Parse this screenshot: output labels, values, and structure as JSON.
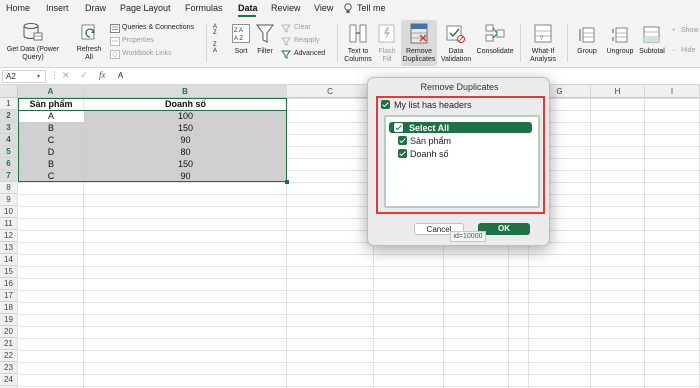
{
  "menu": {
    "tabs": [
      "Home",
      "Insert",
      "Draw",
      "Page Layout",
      "Formulas",
      "Data",
      "Review",
      "View"
    ],
    "active_tab": "Data",
    "tell_me": "Tell me"
  },
  "ribbon": {
    "get_data": [
      "Get Data (Power",
      "Query)"
    ],
    "refresh_all": [
      "Refresh",
      "All"
    ],
    "queries_connections": "Queries & Connections",
    "properties": "Properties",
    "workbook_links": "Workbook Links",
    "sort": "Sort",
    "filter": "Filter",
    "clear": "Clear",
    "reapply": "Reapply",
    "advanced": "Advanced",
    "text_to_columns": [
      "Text to",
      "Columns"
    ],
    "flash_fill": [
      "Flash",
      "Fill"
    ],
    "remove_duplicates": [
      "Remove",
      "Duplicates"
    ],
    "data_validation": [
      "Data",
      "Validation"
    ],
    "consolidate": "Consolidate",
    "what_if": [
      "What-If",
      "Analysis"
    ],
    "group": "Group",
    "ungroup": "Ungroup",
    "subtotal": "Subtotal",
    "show": "Show",
    "hide": "Hide"
  },
  "formula_bar": {
    "name_box": "A2",
    "fx": "fx",
    "value": "A"
  },
  "sheet": {
    "columns": [
      "A",
      "B",
      "C",
      "D",
      "E",
      "F",
      "G",
      "H",
      "I"
    ],
    "rows": [
      "1",
      "2",
      "3",
      "4",
      "5",
      "6",
      "7",
      "8",
      "9",
      "10",
      "11",
      "12",
      "13",
      "14",
      "15",
      "16",
      "17",
      "18",
      "19",
      "20",
      "21",
      "22",
      "23",
      "24",
      "25"
    ],
    "headers": [
      "Sản phẩm",
      "Doanh số"
    ],
    "data": [
      [
        "A",
        "100"
      ],
      [
        "B",
        "150"
      ],
      [
        "C",
        "90"
      ],
      [
        "D",
        "80"
      ],
      [
        "B",
        "150"
      ],
      [
        "C",
        "90"
      ]
    ]
  },
  "dialog": {
    "title": "Remove Duplicates",
    "has_headers": "My list has headers",
    "select_all": "Select All",
    "columns": [
      "Sản phẩm",
      "Doanh số"
    ],
    "cancel": "Cancel",
    "ok": "OK",
    "tooltip": "id=10000"
  },
  "colors": {
    "accent": "#1e7145",
    "highlight": "#e53935",
    "selection": "#c8c8c8"
  }
}
